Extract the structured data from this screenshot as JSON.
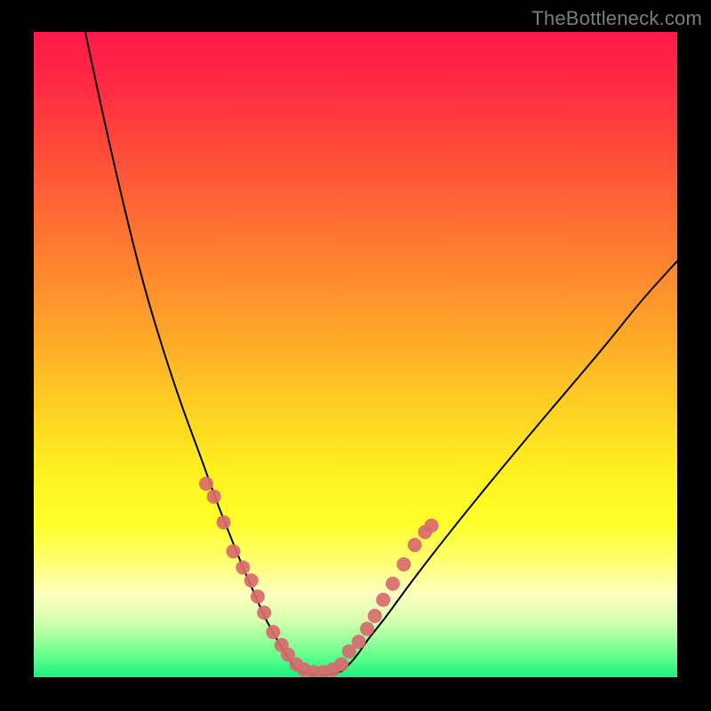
{
  "watermark": "TheBottleneck.com",
  "chart_data": {
    "type": "line",
    "title": "",
    "xlabel": "",
    "ylabel": "",
    "xlim": [
      0,
      1
    ],
    "ylim": [
      0,
      1
    ],
    "grid": false,
    "series": [
      {
        "name": "left-curve",
        "stroke": "#000000",
        "x": [
          0.08,
          0.11,
          0.14,
          0.17,
          0.2,
          0.23,
          0.26,
          0.285,
          0.305,
          0.325,
          0.345,
          0.36,
          0.38,
          0.395,
          0.41
        ],
        "values": [
          1.0,
          0.86,
          0.73,
          0.61,
          0.51,
          0.42,
          0.34,
          0.27,
          0.22,
          0.17,
          0.125,
          0.09,
          0.055,
          0.03,
          0.01
        ]
      },
      {
        "name": "right-curve",
        "stroke": "#000000",
        "x": [
          0.48,
          0.5,
          0.52,
          0.545,
          0.57,
          0.6,
          0.635,
          0.675,
          0.72,
          0.77,
          0.825,
          0.885,
          0.945,
          1.0
        ],
        "values": [
          0.01,
          0.03,
          0.06,
          0.09,
          0.125,
          0.165,
          0.21,
          0.26,
          0.315,
          0.375,
          0.44,
          0.51,
          0.585,
          0.645
        ]
      },
      {
        "name": "plateau",
        "stroke": "#000000",
        "x": [
          0.41,
          0.43,
          0.45,
          0.465,
          0.48
        ],
        "values": [
          0.01,
          0.005,
          0.003,
          0.005,
          0.01
        ]
      }
    ],
    "scatter": [
      {
        "name": "markers-left",
        "color": "#d86a6e",
        "radius_px": 8,
        "x": [
          0.268,
          0.28,
          0.295,
          0.31,
          0.325,
          0.338,
          0.348,
          0.358,
          0.372,
          0.385,
          0.395
        ],
        "values": [
          0.3,
          0.28,
          0.24,
          0.195,
          0.17,
          0.15,
          0.125,
          0.1,
          0.07,
          0.05,
          0.035
        ]
      },
      {
        "name": "markers-right",
        "color": "#d86a6e",
        "radius_px": 8,
        "x": [
          0.49,
          0.505,
          0.518,
          0.53,
          0.543,
          0.558,
          0.575,
          0.592,
          0.608,
          0.618
        ],
        "values": [
          0.04,
          0.055,
          0.075,
          0.095,
          0.12,
          0.145,
          0.175,
          0.205,
          0.225,
          0.235
        ]
      },
      {
        "name": "markers-bottom",
        "color": "#d86a6e",
        "radius_px": 8,
        "x": [
          0.408,
          0.42,
          0.435,
          0.45,
          0.465,
          0.478
        ],
        "values": [
          0.02,
          0.012,
          0.008,
          0.008,
          0.012,
          0.02
        ]
      }
    ]
  }
}
